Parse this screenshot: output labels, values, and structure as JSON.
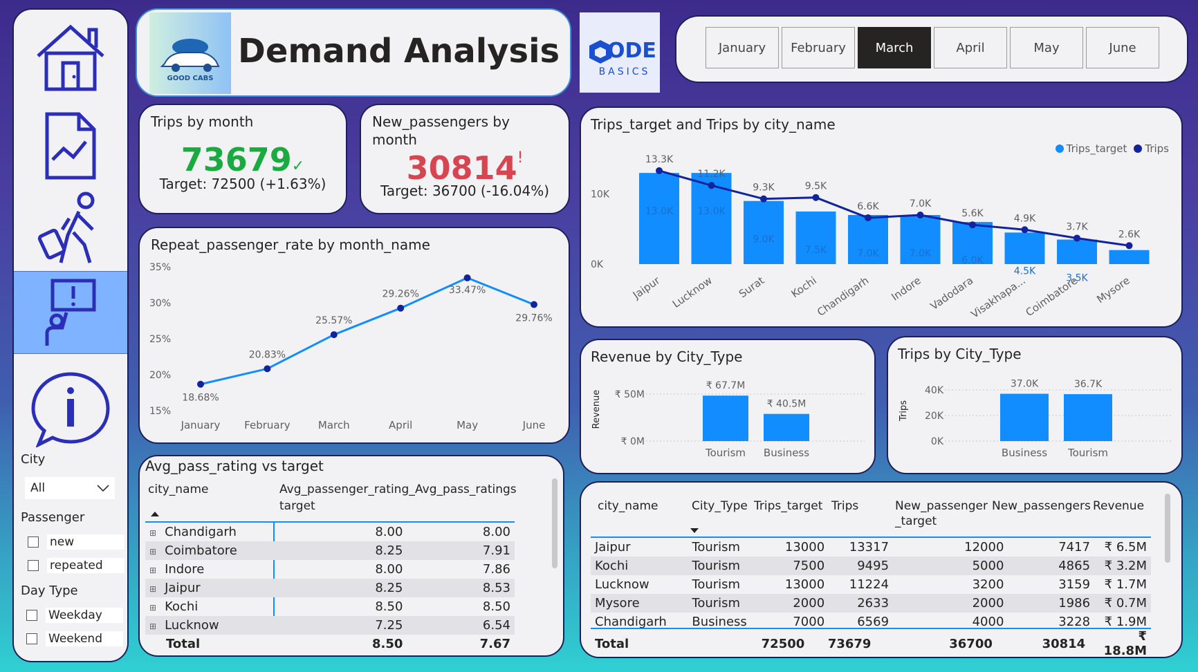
{
  "sidebar": {
    "filters": {
      "city_label": "City",
      "city_value": "All",
      "passenger_label": "Passenger",
      "passenger_options": [
        "new",
        "repeated"
      ],
      "daytype_label": "Day Type",
      "daytype_options": [
        "Weekday",
        "Weekend"
      ]
    }
  },
  "header": {
    "logo_text": "GOOD CABS",
    "title": "Demand Analysis",
    "brand_main": "ODE",
    "brand_sub": "BASICS"
  },
  "months": {
    "items": [
      "January",
      "February",
      "March",
      "April",
      "May",
      "June"
    ],
    "selected": "March"
  },
  "kpi": {
    "trips": {
      "title": "Trips by month",
      "value": "73679",
      "mark": "✓",
      "target": "Target: 72500 (+1.63%)"
    },
    "newp": {
      "title_line1": "New_passengers by",
      "title_line2": "month",
      "value": "30814",
      "mark": "!",
      "target": "Target: 36700 (-16.04%)"
    }
  },
  "colors": {
    "accent": "#118dff",
    "line": "#12239e",
    "good": "#1aab40",
    "bad": "#d64550",
    "dark": "#252423"
  },
  "charts": {
    "repeat": {
      "title": "Repeat_passenger_rate by month_name"
    },
    "trips_city": {
      "title": "Trips_target and Trips by city_name",
      "legend_target": "Trips_target",
      "legend_trips": "Trips"
    },
    "rev_type": {
      "title": "Revenue by City_Type",
      "ylabel": "Revenue"
    },
    "trips_type": {
      "title": "Trips by City_Type",
      "ylabel": "Trips"
    }
  },
  "chart_data": [
    {
      "type": "line",
      "title": "Repeat_passenger_rate by month_name",
      "x": [
        "January",
        "February",
        "March",
        "April",
        "May",
        "June"
      ],
      "series": [
        {
          "values": [
            18.68,
            20.83,
            25.57,
            29.26,
            33.47,
            29.76
          ]
        }
      ],
      "labels": [
        "18.68%",
        "20.83%",
        "25.57%",
        "29.26%",
        "33.47%",
        "29.76%"
      ],
      "ylim": [
        15,
        35
      ],
      "yticks": [
        "15%",
        "20%",
        "25%",
        "30%",
        "35%"
      ],
      "legend": "none"
    },
    {
      "type": "bar",
      "title": "Trips_target and Trips by city_name",
      "categories": [
        "Jaipur",
        "Lucknow",
        "Surat",
        "Kochi",
        "Chandigarh",
        "Indore",
        "Vadodara",
        "Visakhapa...",
        "Coimbatore",
        "Mysore"
      ],
      "series": [
        {
          "name": "Trips_target",
          "values": [
            13000,
            13000,
            9000,
            7500,
            7000,
            7000,
            6000,
            4500,
            3500,
            2000
          ],
          "labels": [
            "13.0K",
            "13.0K",
            "9.0K",
            "7.5K",
            "7.0K",
            "7.0K",
            "6.0K",
            "4.5K",
            "3.5K",
            ""
          ]
        },
        {
          "name": "Trips",
          "type": "line",
          "values": [
            13317,
            11224,
            9300,
            9495,
            6600,
            7000,
            5600,
            4900,
            3700,
            2633
          ],
          "labels": [
            "13.3K",
            "11.2K",
            "9.3K",
            "9.5K",
            "6.6K",
            "7.0K",
            "5.6K",
            "4.9K",
            "3.7K",
            "2.6K"
          ]
        }
      ],
      "ylim": [
        0,
        14000
      ],
      "yticks": [
        "0K",
        "10K"
      ],
      "legend": "top-right"
    },
    {
      "type": "bar",
      "title": "Revenue by City_Type",
      "categories": [
        "Tourism",
        "Business"
      ],
      "values": [
        67.7,
        40.5
      ],
      "labels": [
        "₹ 67.7M",
        "₹ 40.5M"
      ],
      "ylim": [
        0,
        70
      ],
      "yticks": [
        "₹ 0M",
        "₹ 50M"
      ],
      "ylabel": "Revenue"
    },
    {
      "type": "bar",
      "title": "Trips by City_Type",
      "categories": [
        "Business",
        "Tourism"
      ],
      "values": [
        37000,
        36700
      ],
      "labels": [
        "37.0K",
        "36.7K"
      ],
      "ylim": [
        0,
        40000
      ],
      "yticks": [
        "0K",
        "20K",
        "40K"
      ],
      "ylabel": "Trips"
    }
  ],
  "rating_table": {
    "title": "Avg_pass_rating vs target",
    "headers": [
      "city_name",
      "Avg_passenger_rating_",
      "target",
      "Avg_pass_ratings"
    ],
    "rows": [
      [
        "Chandigarh",
        "8.00",
        "8.00"
      ],
      [
        "Coimbatore",
        "8.25",
        "7.91"
      ],
      [
        "Indore",
        "8.00",
        "7.86"
      ],
      [
        "Jaipur",
        "8.25",
        "8.53"
      ],
      [
        "Kochi",
        "8.50",
        "8.50"
      ],
      [
        "Lucknow",
        "7.25",
        "6.54"
      ]
    ],
    "total": [
      "Total",
      "8.50",
      "7.67"
    ]
  },
  "city_table": {
    "headers": [
      "city_name",
      "City_Type",
      "Trips_target",
      "Trips",
      "New_passenger",
      "_target",
      "New_passengers",
      "Revenue"
    ],
    "rows": [
      [
        "Jaipur",
        "Tourism",
        "13000",
        "13317",
        "12000",
        "7417",
        "₹ 6.5M"
      ],
      [
        "Kochi",
        "Tourism",
        "7500",
        "9495",
        "5000",
        "4865",
        "₹ 3.2M"
      ],
      [
        "Lucknow",
        "Tourism",
        "13000",
        "11224",
        "3200",
        "3159",
        "₹ 1.7M"
      ],
      [
        "Mysore",
        "Tourism",
        "2000",
        "2633",
        "2000",
        "1986",
        "₹ 0.7M"
      ],
      [
        "Chandigarh",
        "Business",
        "7000",
        "6569",
        "4000",
        "3228",
        "₹ 1.9M"
      ]
    ],
    "total": [
      "Total",
      "",
      "72500",
      "73679",
      "36700",
      "30814",
      "₹ 18.8M"
    ]
  }
}
